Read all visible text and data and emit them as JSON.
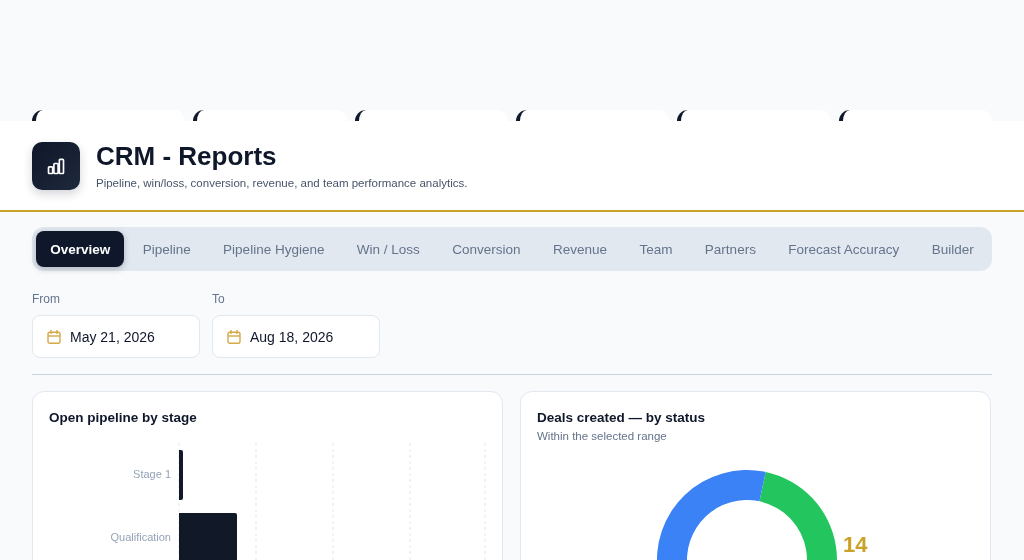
{
  "header": {
    "title": "CRM - Reports",
    "subtitle": "Pipeline, win/loss, conversion, revenue, and team performance analytics."
  },
  "tabs": [
    {
      "label": "Overview",
      "selected": true
    },
    {
      "label": "Pipeline",
      "selected": false
    },
    {
      "label": "Pipeline Hygiene",
      "selected": false
    },
    {
      "label": "Win / Loss",
      "selected": false
    },
    {
      "label": "Conversion",
      "selected": false
    },
    {
      "label": "Revenue",
      "selected": false
    },
    {
      "label": "Team",
      "selected": false
    },
    {
      "label": "Partners",
      "selected": false
    },
    {
      "label": "Forecast Accuracy",
      "selected": false
    },
    {
      "label": "Builder",
      "selected": false
    }
  ],
  "date_range": {
    "from": {
      "label": "From",
      "value": "May 21, 2026"
    },
    "to": {
      "label": "To",
      "value": "Aug 18, 2026"
    }
  },
  "open_pipeline_card": {
    "title": "Open pipeline by stage",
    "stage_labels": [
      "Stage 1",
      "Qualification"
    ]
  },
  "deals_card": {
    "title": "Deals created — by status",
    "subtitle": "Within the selected range",
    "value_label": "14"
  }
}
